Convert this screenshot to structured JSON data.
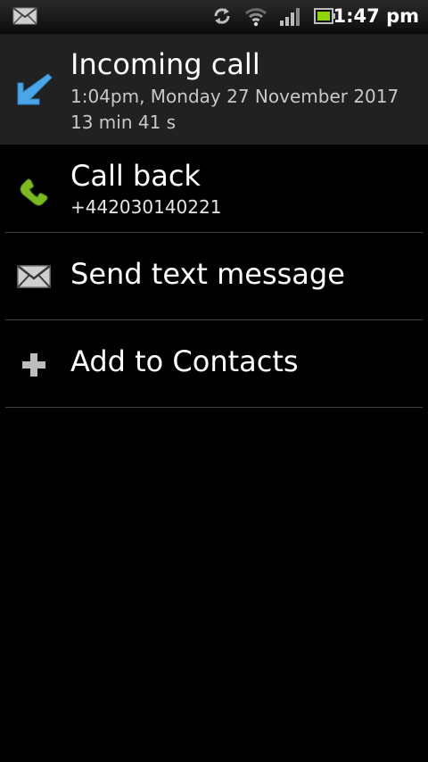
{
  "status_bar": {
    "time": "1:47 pm",
    "icons": [
      "mail-notification-icon",
      "sync-icon",
      "wifi-icon",
      "signal-icon",
      "battery-icon"
    ]
  },
  "call": {
    "title": "Incoming call",
    "datetime": "1:04pm, Monday 27 November 2017",
    "duration": "13 min 41 s",
    "icon": "incoming-call-arrow-icon",
    "arrow_color": "#4aa6e6"
  },
  "actions": [
    {
      "label": "Call back",
      "sublabel": "+442030140221",
      "icon": "phone-icon",
      "icon_color": "#7cbb1e"
    },
    {
      "label": "Send text message",
      "icon": "envelope-icon"
    },
    {
      "label": "Add to Contacts",
      "icon": "plus-icon"
    }
  ]
}
